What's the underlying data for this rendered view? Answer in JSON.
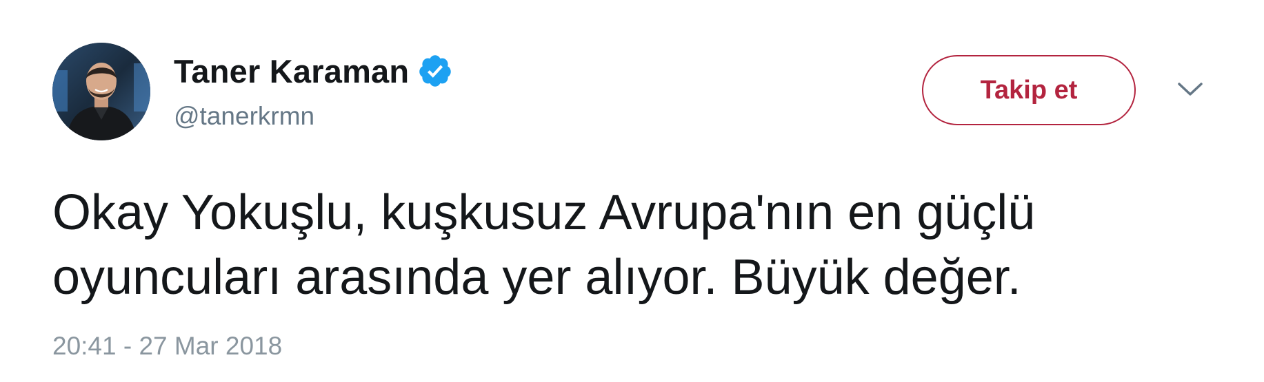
{
  "author": {
    "display_name": "Taner Karaman",
    "handle": "@tanerkrmn",
    "verified": true
  },
  "actions": {
    "follow_label": "Takip et",
    "menu_icon": "chevron-down-icon"
  },
  "tweet": {
    "text_lines": [
      "Okay Yokuşlu, kuşkusuz Avrupa'nın en güçlü",
      "oyuncuları arasında yer alıyor. Büyük değer."
    ],
    "timestamp": "20:41 - 27 Mar 2018"
  },
  "colors": {
    "follow_accent": "#b3243f",
    "verified_badge": "#1da1f2",
    "secondary_text": "#657786"
  }
}
